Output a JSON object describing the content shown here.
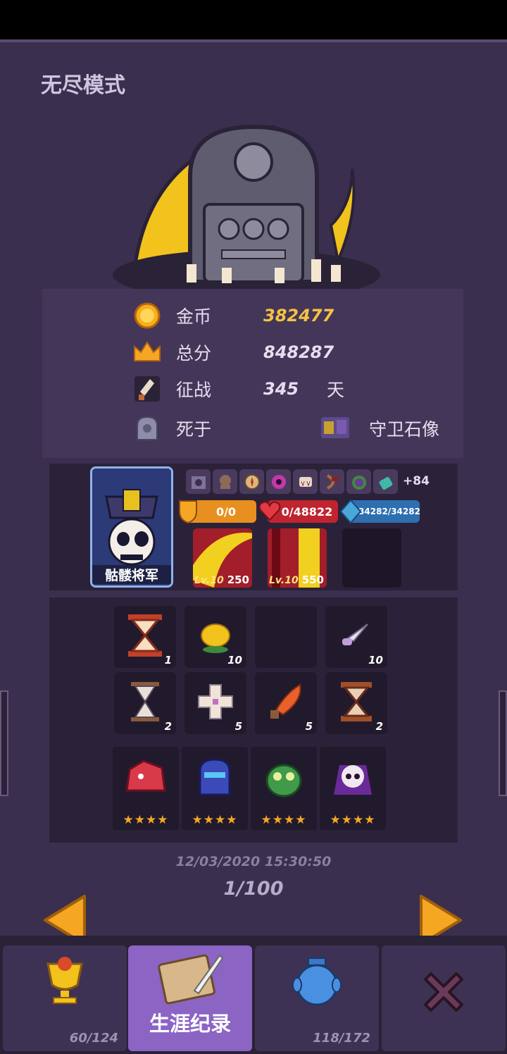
{
  "mode_title": "无尽模式",
  "stats": {
    "gold": {
      "label": "金币",
      "value": "382477"
    },
    "score": {
      "label": "总分",
      "value": "848287"
    },
    "days": {
      "label": "征战",
      "value": "345",
      "unit": "天"
    },
    "death": {
      "label": "死于",
      "killer": "守卫石像"
    }
  },
  "hero": {
    "name": "骷髅将军",
    "more_buffs": "+84",
    "shield": "0/0",
    "hp": "0/48822",
    "mana": "34282/34282",
    "weapons": [
      {
        "level": "Lv.10",
        "power": "250"
      },
      {
        "level": "Lv.10",
        "power": "550"
      }
    ]
  },
  "items": [
    {
      "icon": "red-hourglass-icon",
      "count": "1"
    },
    {
      "icon": "lemon-icon",
      "count": "10"
    },
    {
      "icon": "empty-slot",
      "count": ""
    },
    {
      "icon": "knife-icon",
      "count": "10"
    },
    {
      "icon": "hourglass-icon",
      "count": "2"
    },
    {
      "icon": "cross-icon",
      "count": "5"
    },
    {
      "icon": "flame-blade-icon",
      "count": "5"
    },
    {
      "icon": "bronze-hourglass-icon",
      "count": "2"
    }
  ],
  "pets": [
    {
      "icon": "red-beast-pet-icon",
      "stars": "★★★★"
    },
    {
      "icon": "blue-knight-pet-icon",
      "stars": "★★★★"
    },
    {
      "icon": "green-owl-pet-icon",
      "stars": "★★★★"
    },
    {
      "icon": "purple-skull-pet-icon",
      "stars": "★★★★"
    }
  ],
  "record_date": "12/03/2020 15:30:50",
  "page_indicator": "1/100",
  "tabs": [
    {
      "icon": "trophy-icon",
      "count": "60/124",
      "label": ""
    },
    {
      "icon": "scroll-quill-icon",
      "count": "",
      "label": "生涯纪录"
    },
    {
      "icon": "jar-icon",
      "count": "118/172",
      "label": ""
    },
    {
      "icon": "close-icon",
      "count": "",
      "label": ""
    }
  ],
  "colors": {
    "panel": "#3b2f4f",
    "accent_gold": "#f5c242",
    "active_tab": "#8b64c4",
    "hp_red": "#c0242f",
    "shield_orange": "#e8901f",
    "mana_blue": "#2e6fb0"
  }
}
